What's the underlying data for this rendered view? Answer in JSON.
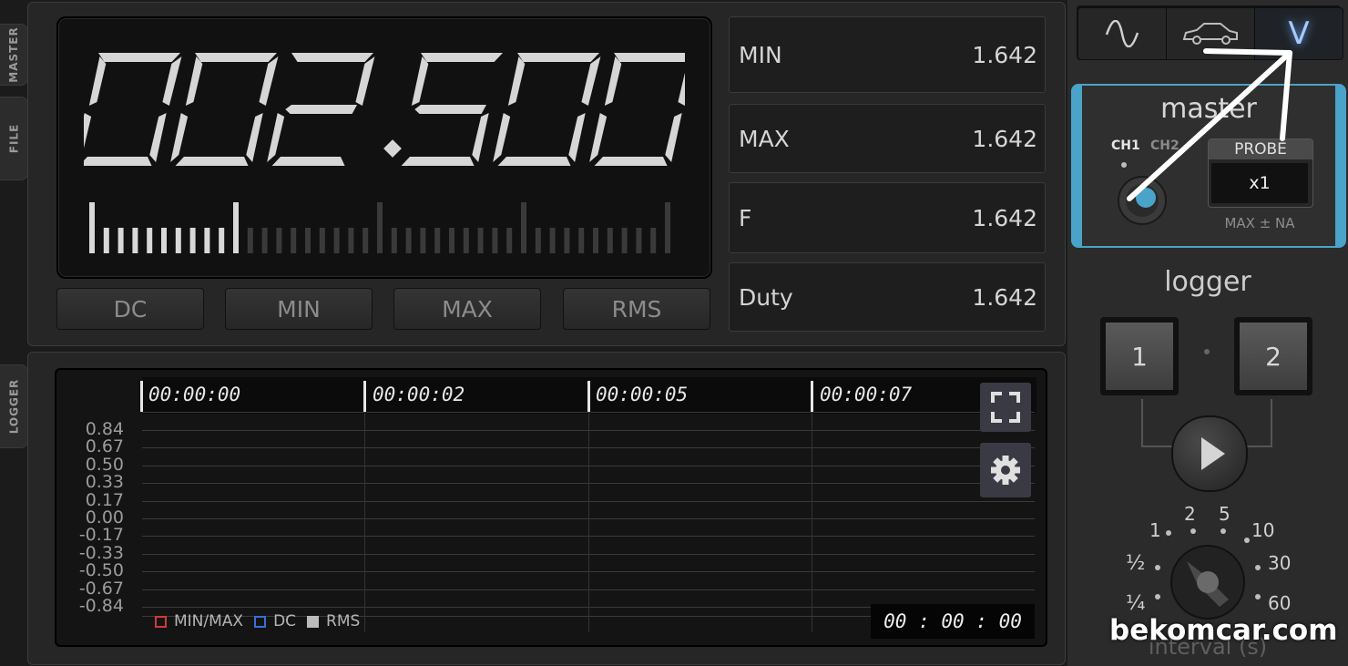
{
  "side_tabs": {
    "master": "MASTER",
    "file": "FILE",
    "logger": "LOGGER"
  },
  "display": {
    "reading": "002.500",
    "bar_level": 0.25
  },
  "mode_buttons": [
    {
      "label": "DC",
      "active": true
    },
    {
      "label": "MIN",
      "active": false
    },
    {
      "label": "MAX",
      "active": false
    },
    {
      "label": "RMS",
      "active": false
    }
  ],
  "stats": [
    {
      "label": "MIN",
      "value": "1.642"
    },
    {
      "label": "MAX",
      "value": "1.642"
    },
    {
      "label": "F",
      "value": "1.642"
    },
    {
      "label": "Duty",
      "value": "1.642"
    }
  ],
  "logger_chart": {
    "time_labels": [
      "00:00:00",
      "00:00:02",
      "00:00:05",
      "00:00:07"
    ],
    "y_labels": [
      "0.84",
      "0.67",
      "0.50",
      "0.33",
      "0.17",
      "0.00",
      "-0.17",
      "-0.33",
      "-0.50",
      "-0.67",
      "-0.84"
    ],
    "legend": [
      "MIN/MAX",
      "DC",
      "RMS"
    ],
    "elapsed": "00 : 00 : 00"
  },
  "mode_tabs": [
    "sine-wave-icon",
    "car-icon",
    "voltage-icon"
  ],
  "mode_tab_v": "V",
  "master": {
    "title": "master",
    "ch1": "CH1",
    "ch2": "CH2",
    "probe_label": "PROBE",
    "probe_value": "x1",
    "range": "MAX ± NA"
  },
  "logger": {
    "title": "logger",
    "btn1": "1",
    "btn2": "2",
    "intervals": [
      "1",
      "2",
      "5",
      "10",
      "½",
      "30",
      "¼",
      "60"
    ],
    "interval_label": "interval (s)"
  },
  "watermark": "bekomcar.com",
  "colors": {
    "master_accent": "#4aa3c9",
    "legend_minmax": "#d23a3a",
    "legend_dc": "#3a6fd2",
    "legend_rms": "#bbbbbb",
    "arrow": "#ffffff"
  }
}
